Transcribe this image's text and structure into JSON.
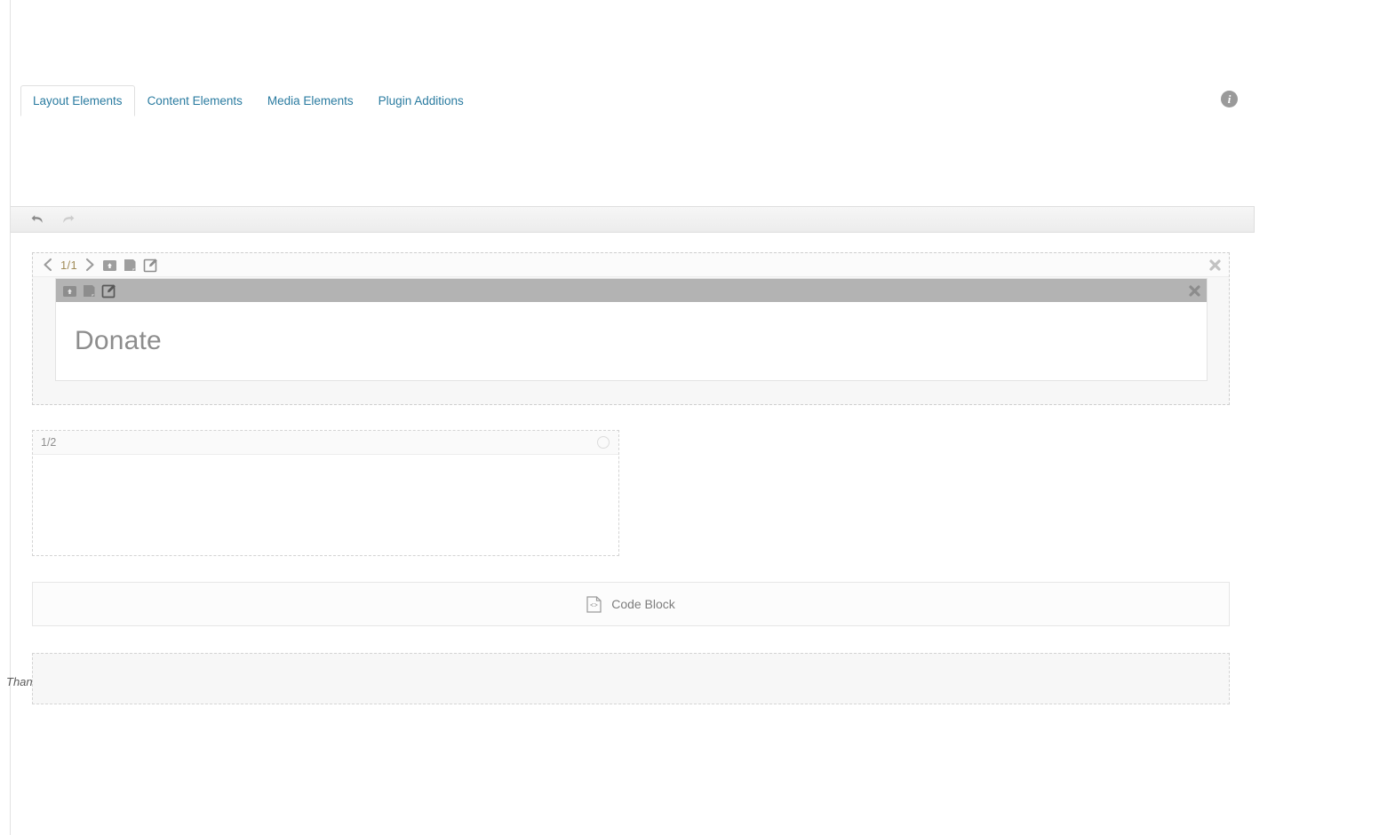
{
  "tabs": [
    {
      "label": "Layout Elements",
      "active": true
    },
    {
      "label": "Content Elements",
      "active": false
    },
    {
      "label": "Media Elements",
      "active": false
    },
    {
      "label": "Plugin Additions",
      "active": false
    }
  ],
  "header": {
    "info_icon": "info-icon",
    "info_glyph": "i"
  },
  "toolbar": {
    "undo": "undo-arrow-icon",
    "redo": "redo-arrow-icon"
  },
  "row": {
    "prev_icon": "chevron-left-icon",
    "next_icon": "chevron-right-icon",
    "count": "1/1",
    "move_icon": "move-row-icon",
    "clone_icon": "clone-row-icon",
    "edit_icon": "edit-row-icon",
    "close_icon": "close-icon",
    "element": {
      "move_icon": "move-element-icon",
      "clone_icon": "clone-element-icon",
      "edit_icon": "edit-element-icon",
      "close_icon": "close-icon",
      "text": "Donate"
    }
  },
  "column": {
    "label": "1/2",
    "handle_icon": "circle-handle-icon"
  },
  "code_block": {
    "icon": "code-file-icon",
    "label": "Code Block"
  },
  "thanks": {
    "text": "Than"
  },
  "colors": {
    "tab_text": "#2a7ba0",
    "row_count": "#a08b57",
    "element_bar": "#b3b3b3",
    "donate_text": "#8d8d8d",
    "page_bg": "#ffffff"
  }
}
